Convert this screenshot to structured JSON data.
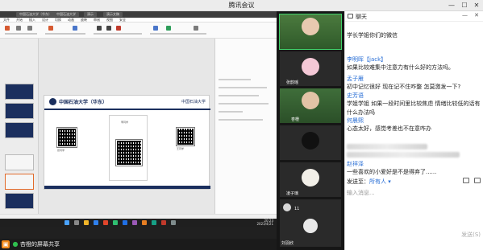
{
  "window": {
    "title": "腾讯会议",
    "minimize": "—",
    "maximize": "☐",
    "close": "✕"
  },
  "shared": {
    "tabs": [
      "中国石油大学（华东）",
      "中国石油大学",
      "演示",
      "演示文稿"
    ],
    "menus": [
      "文件",
      "开始",
      "插入",
      "设计",
      "切换",
      "动画",
      "放映",
      "审阅",
      "视图",
      "安全"
    ],
    "slide": {
      "title": "中国石油大学（华东）",
      "title_right": "中国石油大学",
      "qr_names": [
        "张同学",
        "李同学",
        "王同学"
      ]
    },
    "clock": {
      "time": "20:23",
      "date": "2023/4/21"
    }
  },
  "share_bar": {
    "text": "杏橙的屏幕共享"
  },
  "participants": [
    {
      "name": "",
      "active": true
    },
    {
      "name": "张韵瑶"
    },
    {
      "name": "杏橙"
    },
    {
      "name": ""
    },
    {
      "name": "凌子璃"
    },
    {
      "name": "11"
    },
    {
      "name": "刘羽欣"
    }
  ],
  "chat": {
    "title": "聊天",
    "messages": [
      {
        "name": "",
        "text": "学长学姐你们的微信"
      },
      {
        "name": "李明晖【jack】",
        "text": "如果比较难集中注意力有什么好的方法吗。"
      },
      {
        "name": "孟子雁",
        "text": "初中记忆很好 现在记不住咋整 怎莫激发一下?"
      },
      {
        "name": "史芳语",
        "text": "学姐学姐 如果一段时间里比较焦虑 情绪比较低的话有什么办法吗"
      },
      {
        "name": "何晨熙",
        "text": "心态太好，感觉考差也不在意咋办"
      },
      {
        "name": "赵祥泽",
        "text": "一些喜欢的小爱好是不是得弃了......"
      }
    ],
    "send_to_label": "发送至：",
    "send_to_value": "所有人 ▾",
    "input_placeholder": "输入消息...",
    "send_button": "发送(S)"
  }
}
